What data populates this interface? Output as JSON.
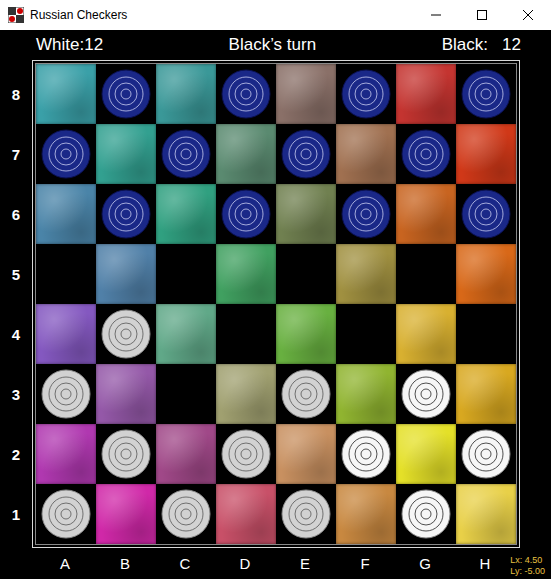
{
  "window": {
    "title": "Russian Checkers"
  },
  "header": {
    "white_score": "White:12",
    "turn": "Black’s turn",
    "black_score": "Black:   12"
  },
  "files": [
    "A",
    "B",
    "C",
    "D",
    "E",
    "F",
    "G",
    "H"
  ],
  "board": [
    {
      "rank": "8",
      "cells": [
        {
          "piece": "none",
          "lit": false
        },
        {
          "piece": "black",
          "lit": false
        },
        {
          "piece": "none",
          "lit": false
        },
        {
          "piece": "black",
          "lit": false
        },
        {
          "piece": "none",
          "lit": false
        },
        {
          "piece": "black",
          "lit": false
        },
        {
          "piece": "none",
          "lit": false
        },
        {
          "piece": "black",
          "lit": false
        }
      ]
    },
    {
      "rank": "7",
      "cells": [
        {
          "piece": "black",
          "lit": false
        },
        {
          "piece": "none",
          "lit": false
        },
        {
          "piece": "black",
          "lit": false
        },
        {
          "piece": "none",
          "lit": false
        },
        {
          "piece": "black",
          "lit": false
        },
        {
          "piece": "none",
          "lit": false
        },
        {
          "piece": "black",
          "lit": false
        },
        {
          "piece": "none",
          "lit": false
        }
      ]
    },
    {
      "rank": "6",
      "cells": [
        {
          "piece": "none",
          "lit": false
        },
        {
          "piece": "black",
          "lit": false
        },
        {
          "piece": "none",
          "lit": false
        },
        {
          "piece": "black",
          "lit": false
        },
        {
          "piece": "none",
          "lit": false
        },
        {
          "piece": "black",
          "lit": false
        },
        {
          "piece": "none",
          "lit": false
        },
        {
          "piece": "black",
          "lit": false
        }
      ]
    },
    {
      "rank": "5",
      "cells": [
        {
          "piece": "none",
          "lit": false
        },
        {
          "piece": "none",
          "lit": false
        },
        {
          "piece": "none",
          "lit": false
        },
        {
          "piece": "none",
          "lit": false
        },
        {
          "piece": "none",
          "lit": false
        },
        {
          "piece": "none",
          "lit": false
        },
        {
          "piece": "none",
          "lit": false
        },
        {
          "piece": "none",
          "lit": false
        }
      ]
    },
    {
      "rank": "4",
      "cells": [
        {
          "piece": "none",
          "lit": false
        },
        {
          "piece": "white",
          "lit": false
        },
        {
          "piece": "none",
          "lit": false
        },
        {
          "piece": "none",
          "lit": false
        },
        {
          "piece": "none",
          "lit": false
        },
        {
          "piece": "none",
          "lit": false
        },
        {
          "piece": "none",
          "lit": false
        },
        {
          "piece": "none",
          "lit": false
        }
      ]
    },
    {
      "rank": "3",
      "cells": [
        {
          "piece": "white",
          "lit": false
        },
        {
          "piece": "none",
          "lit": false
        },
        {
          "piece": "none",
          "lit": false
        },
        {
          "piece": "none",
          "lit": false
        },
        {
          "piece": "white",
          "lit": false
        },
        {
          "piece": "none",
          "lit": false
        },
        {
          "piece": "white",
          "lit": true
        },
        {
          "piece": "none",
          "lit": false
        }
      ]
    },
    {
      "rank": "2",
      "cells": [
        {
          "piece": "none",
          "lit": false
        },
        {
          "piece": "white",
          "lit": false
        },
        {
          "piece": "none",
          "lit": false
        },
        {
          "piece": "white",
          "lit": false
        },
        {
          "piece": "none",
          "lit": false
        },
        {
          "piece": "white",
          "lit": true
        },
        {
          "piece": "none",
          "lit": false
        },
        {
          "piece": "white",
          "lit": true
        }
      ]
    },
    {
      "rank": "1",
      "cells": [
        {
          "piece": "white",
          "lit": false
        },
        {
          "piece": "none",
          "lit": false
        },
        {
          "piece": "white",
          "lit": false
        },
        {
          "piece": "none",
          "lit": false
        },
        {
          "piece": "white",
          "lit": false
        },
        {
          "piece": "none",
          "lit": false
        },
        {
          "piece": "white",
          "lit": true
        },
        {
          "piece": "none",
          "lit": false
        }
      ]
    }
  ],
  "coordinates": [
    "Lx: 4.50",
    "Ly: -5.00"
  ]
}
